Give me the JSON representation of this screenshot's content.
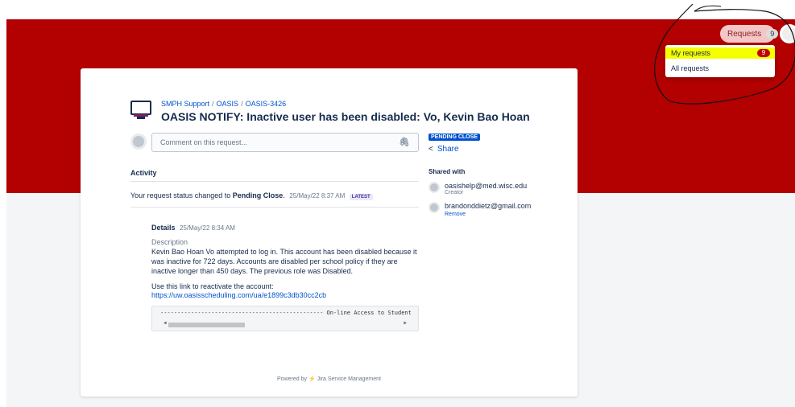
{
  "header": {
    "requests_label": "Requests",
    "requests_count": "9",
    "dropdown": {
      "my_requests_label": "My requests",
      "my_requests_count": "9",
      "all_requests_label": "All requests"
    }
  },
  "issue": {
    "breadcrumb": [
      "SMPH Support",
      "OASIS",
      "OASIS-3426"
    ],
    "breadcrumb_sep": "/",
    "title": "OASIS NOTIFY: Inactive user has been disabled: Vo, Kevin Bao Hoan",
    "comment_placeholder": "Comment on this request...",
    "status": "PENDING CLOSE",
    "share_label": "Share"
  },
  "activity": {
    "heading": "Activity",
    "status_prefix": "Your request status changed to",
    "status_value": "Pending Close",
    "status_suffix": ".",
    "status_time": "25/May/22 8:37 AM",
    "latest_label": "LATEST",
    "details_label": "Details",
    "details_time": "25/May/22 8:34 AM",
    "description_label": "Description",
    "description_text": "Kevin Bao Hoan Vo attempted to log in. This account has been disabled because it was inactive for 722 days. Accounts are disabled per school policy if they are inactive longer than 450 days. The previous role was Disabled.",
    "link_intro": "Use this link to reactivate the account:",
    "link_url": "https://uw.oasisscheduling.com/ua/e1899c3db30cc2cb",
    "code_text": "------------------------------------------------ On-line Access to Student"
  },
  "shared": {
    "heading": "Shared with",
    "participants": [
      {
        "email": "oasishelp@med.wisc.edu",
        "role": "Creator"
      },
      {
        "email": "brandonddietz@gmail.com",
        "action": "Remove"
      }
    ]
  },
  "footer": {
    "powered_by": "Powered by",
    "product": "Jira Service Management"
  },
  "colors": {
    "banner": "#b30000",
    "highlight": "#f5ff00",
    "link": "#0052cc",
    "status_lozenge": "#0052cc"
  },
  "icons": [
    "monitor-icon",
    "paperclip-icon",
    "share-icon",
    "bolt-icon",
    "avatar-icon"
  ]
}
